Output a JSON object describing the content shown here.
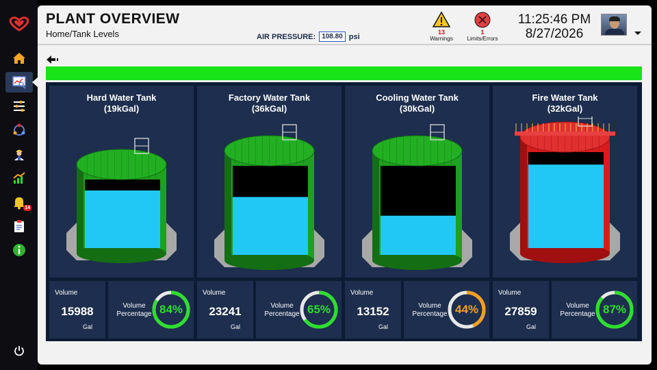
{
  "header": {
    "title": "PLANT OVERVIEW",
    "breadcrumb": "Home/Tank Levels",
    "air_pressure_label": "AIR PRESSURE:",
    "air_pressure_value": "108.80",
    "air_pressure_unit": "psi",
    "warnings": {
      "count": "13",
      "label": "Warnings"
    },
    "errors": {
      "count": "1",
      "label": "Limits/Errors"
    },
    "time": "11:25:46 PM",
    "date": "8/27/2026"
  },
  "sidebar": {
    "items": [
      {
        "icon": "home-icon"
      },
      {
        "icon": "monitor-chart-icon",
        "active": true
      },
      {
        "icon": "sliders-icon"
      },
      {
        "icon": "cycle-icon"
      },
      {
        "icon": "worker-icon"
      },
      {
        "icon": "trend-chart-icon"
      },
      {
        "icon": "bell-icon",
        "badge": "14"
      },
      {
        "icon": "clipboard-icon"
      },
      {
        "icon": "info-icon"
      }
    ]
  },
  "level_bar_color": "#17e317",
  "tanks": [
    {
      "name": "Hard Water Tank",
      "capacity": "(19kGal)",
      "volume_label": "Volume",
      "volume": "15988",
      "unit": "Gal",
      "pct_label": "Volume Percentage",
      "percent": 84,
      "percent_text": "84%",
      "color": "#2ddf2d",
      "tank_color": "green",
      "fill": 0.84
    },
    {
      "name": "Factory Water Tank",
      "capacity": "(36kGal)",
      "volume_label": "Volume",
      "volume": "23241",
      "unit": "Gal",
      "pct_label": "Volume Percentage",
      "percent": 65,
      "percent_text": "65%",
      "color": "#2ddf2d",
      "tank_color": "green",
      "fill": 0.65
    },
    {
      "name": "Cooling Water Tank",
      "capacity": "(30kGal)",
      "volume_label": "Volume",
      "volume": "13152",
      "unit": "Gal",
      "pct_label": "Volume Percentage",
      "percent": 44,
      "percent_text": "44%",
      "color": "#f5a020",
      "tank_color": "green",
      "fill": 0.44
    },
    {
      "name": "Fire Water Tank",
      "capacity": "(32kGal)",
      "volume_label": "Volume",
      "volume": "27859",
      "unit": "Gal",
      "pct_label": "Volume Percentage",
      "percent": 87,
      "percent_text": "87%",
      "color": "#2ddf2d",
      "tank_color": "red",
      "fill": 0.87
    }
  ]
}
